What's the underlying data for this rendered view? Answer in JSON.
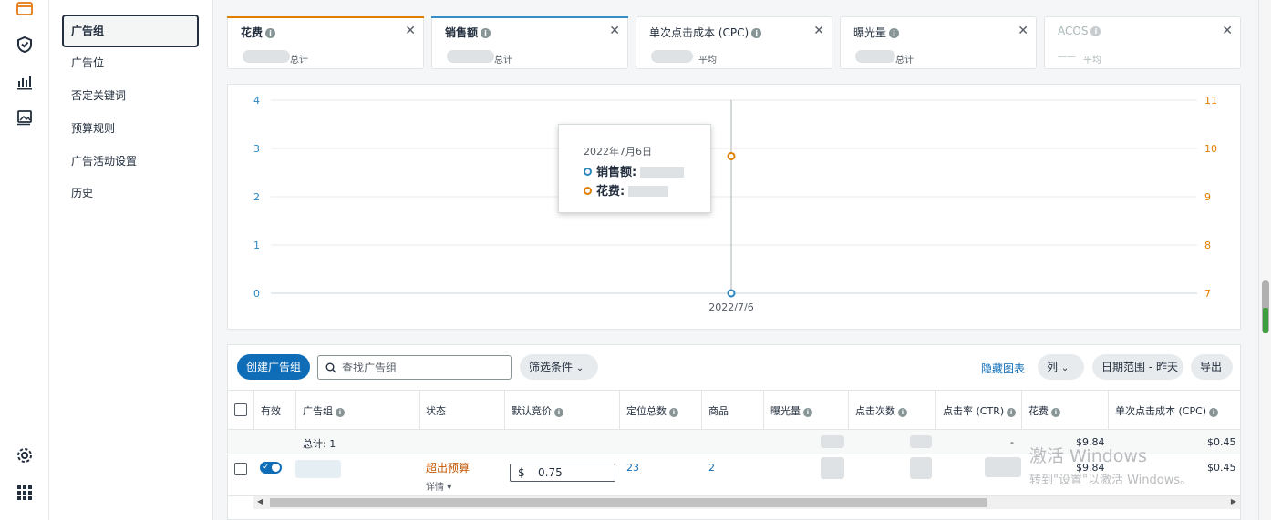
{
  "nav": {
    "items": [
      "广告组",
      "广告位",
      "否定关键词",
      "预算规则",
      "广告活动设置",
      "历史"
    ]
  },
  "metrics": [
    {
      "title": "花费",
      "sub": "总计",
      "color": "#e07e00"
    },
    {
      "title": "销售额",
      "sub": "总计",
      "color": "#3a8cc8"
    },
    {
      "title": "单次点击成本 (CPC)",
      "sub": "平均",
      "color": ""
    },
    {
      "title": "曝光量",
      "sub": "总计",
      "color": ""
    },
    {
      "title": "ACOS",
      "sub": "平均",
      "color": ""
    }
  ],
  "metric_placeholder": "——",
  "chart_data": {
    "type": "line",
    "x": [
      "2022/7/6"
    ],
    "series": [
      {
        "name": "销售额",
        "axis": "left",
        "color": "#2b87c4",
        "values": [
          0
        ]
      },
      {
        "name": "花费",
        "axis": "right",
        "color": "#e07e00",
        "values": [
          9.84
        ]
      }
    ],
    "y_left_ticks": [
      0,
      1,
      2,
      3,
      4
    ],
    "y_right_ticks": [
      7,
      8,
      9,
      10,
      11
    ],
    "ylim_left": [
      0,
      4
    ],
    "ylim_right": [
      7,
      11
    ],
    "grid": true,
    "tooltip": {
      "date": "2022年7月6日",
      "rows": [
        "销售额:",
        "花费:"
      ]
    }
  },
  "toolbar": {
    "create_label": "创建广告组",
    "search_placeholder": "查找广告组",
    "filter_label": "筛选条件",
    "hide_chart_label": "隐藏图表",
    "columns_label": "列",
    "date_range_label": "日期范围 - 昨天",
    "export_label": "导出"
  },
  "table": {
    "headers": [
      "有效",
      "广告组",
      "状态",
      "默认竞价",
      "定位总数",
      "商品",
      "曝光量",
      "点击次数",
      "点击率 (CTR)",
      "花费",
      "单次点击成本 (CPC)"
    ],
    "total_row": {
      "label": "总计: 1",
      "ctr": "-",
      "spend": "$9.84",
      "cpc": "$0.45"
    },
    "rows": [
      {
        "status": "超出预算",
        "details": "详情",
        "bid_currency": "$",
        "bid": "0.75",
        "targets": "23",
        "products": "2",
        "spend": "$9.84",
        "cpc": "$0.45"
      }
    ]
  },
  "watermark": {
    "line1": "激活 Windows",
    "line2": "转到\"设置\"以激活 Windows。"
  }
}
